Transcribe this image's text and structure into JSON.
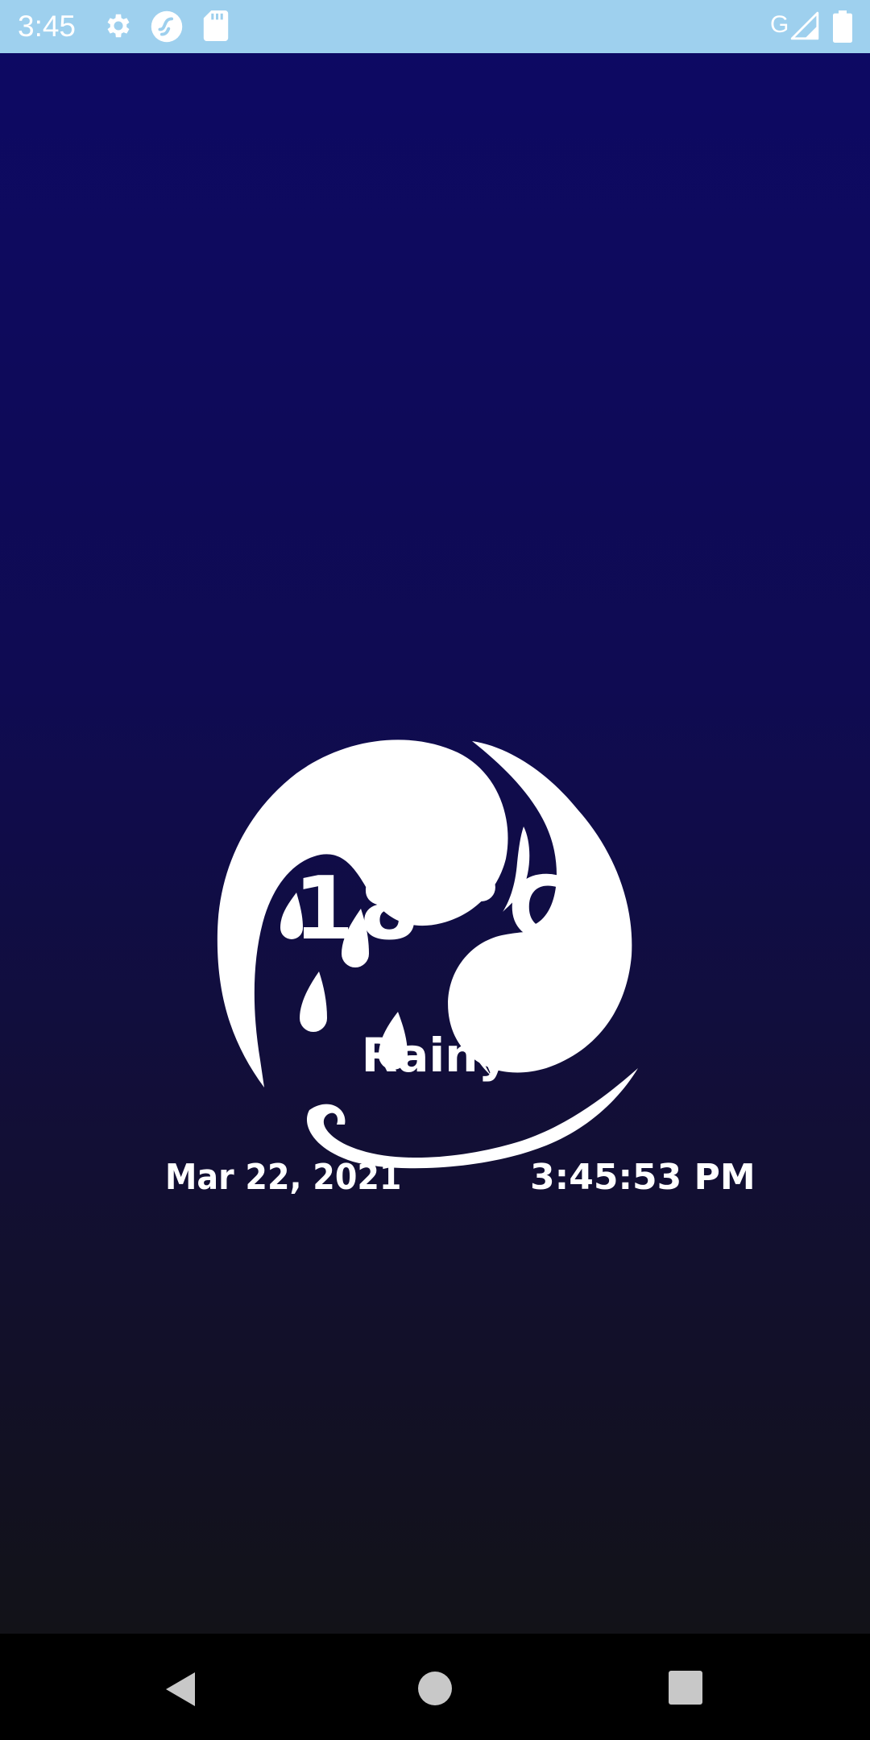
{
  "status_bar": {
    "time": "3:45",
    "network_label": "G",
    "icons": [
      "gear-icon",
      "sync-icon",
      "sd-card-icon",
      "signal-icon",
      "battery-icon"
    ]
  },
  "weather": {
    "temperature": "18 °C",
    "condition": "Rainy",
    "date": "Mar 22, 2021",
    "time": "3:45:53 PM",
    "icon": "rain-cloud-swirl-icon"
  },
  "nav_bar": {
    "icons": [
      "back-icon",
      "home-icon",
      "recents-icon"
    ]
  },
  "colors": {
    "status_bar": "#9ed0ee",
    "gradient_top": "#0d0963",
    "gradient_bottom": "#121218",
    "text": "#ffffff"
  }
}
